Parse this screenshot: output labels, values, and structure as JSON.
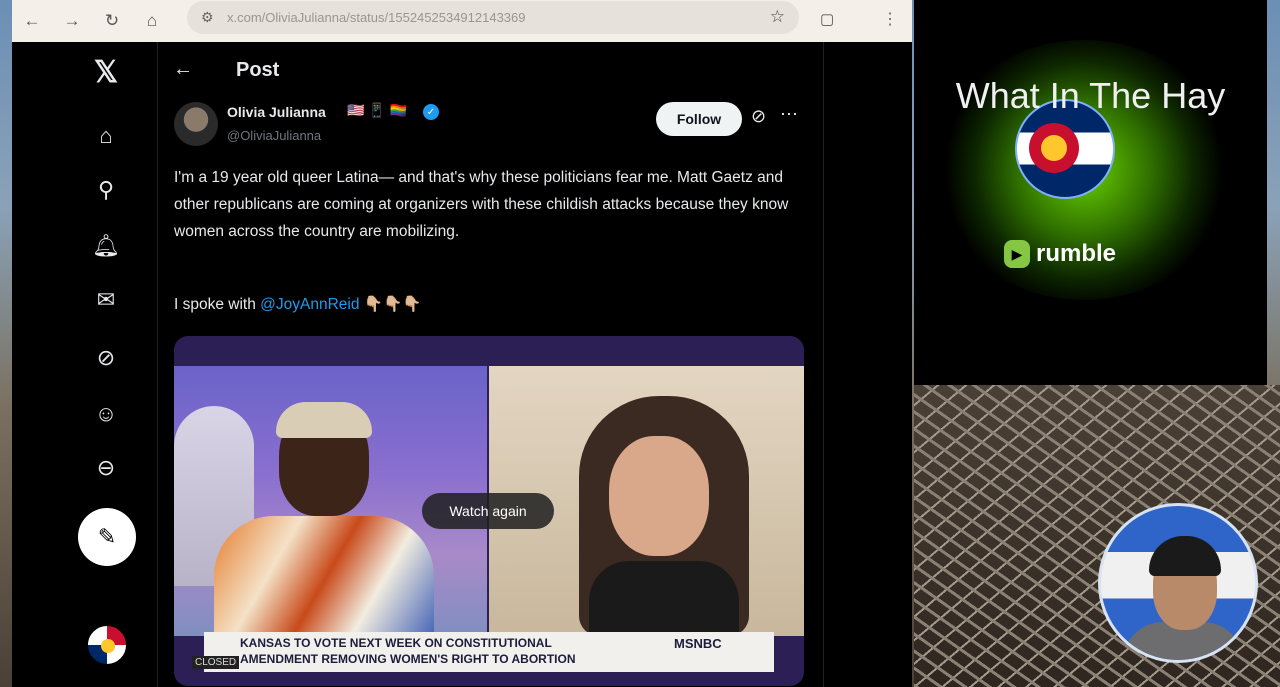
{
  "browser": {
    "url": "x.com/OliviaJulianna/status/1552452534912143369",
    "back_icon": "arrow-left",
    "forward_icon": "arrow-right",
    "reload_icon": "reload",
    "home_icon": "home"
  },
  "x": {
    "header_title": "Post",
    "author": {
      "name": "Olivia Julianna",
      "emojis": "🇺🇸 📱 🏳️‍🌈",
      "handle": "@OliviaJulianna"
    },
    "follow_label": "Follow",
    "tweet_text": "I'm a 19 year old queer Latina— and that's why these politicians fear me. Matt Gaetz and other republicans are coming at organizers with these childish attacks because they know women across the country are mobilizing.",
    "tweet_line2_prefix": "I spoke with ",
    "mention": "@JoyAnnReid",
    "tweet_line2_suffix": " 👇🏼👇🏼👇🏼",
    "video": {
      "watch_again_label": "Watch again",
      "chyron_line1": "KANSAS TO VOTE NEXT WEEK ON CONSTITUTIONAL",
      "chyron_line2": "AMENDMENT REMOVING WOMEN'S RIGHT TO ABORTION",
      "network": "MSNBC",
      "bug": "CLOSED"
    }
  },
  "rumble": {
    "channel_title": "What In The Hay",
    "brand": "rumble",
    "accent_color": "#85c742"
  }
}
